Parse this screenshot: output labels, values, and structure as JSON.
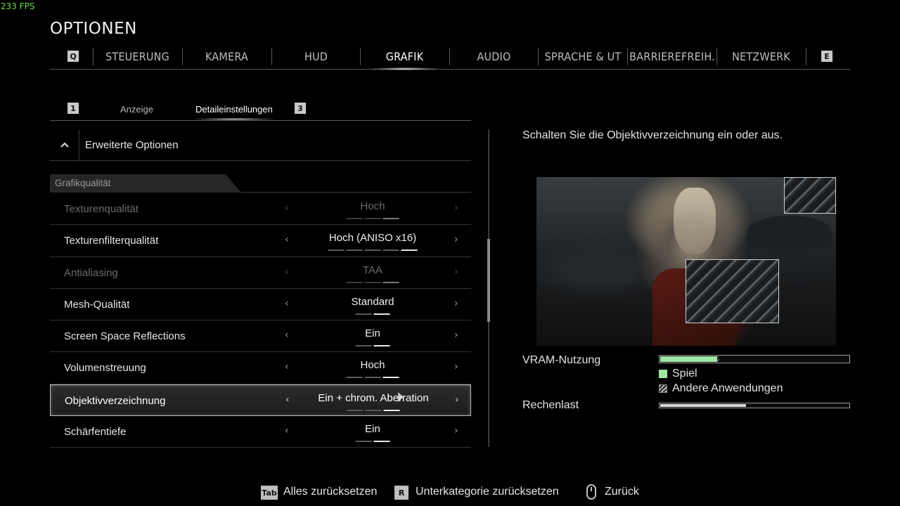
{
  "fps": "233 FPS",
  "title": "OPTIONEN",
  "top_tabs": {
    "left_key": "Q",
    "right_key": "E",
    "items": [
      {
        "label": "STEUERUNG"
      },
      {
        "label": "KAMERA"
      },
      {
        "label": "HUD"
      },
      {
        "label": "GRAFIK",
        "active": true
      },
      {
        "label": "AUDIO"
      },
      {
        "label": "SPRACHE & UT"
      },
      {
        "label": "BARRIEREFREIH."
      },
      {
        "label": "NETZWERK"
      }
    ]
  },
  "sub_tabs": {
    "left_key": "1",
    "right_key": "3",
    "items": [
      {
        "label": "Anzeige"
      },
      {
        "label": "Detaileinstellungen",
        "active": true
      }
    ]
  },
  "expander": {
    "label": "Erweiterte Optionen",
    "icon": "chevron-up-icon"
  },
  "section": {
    "label": "Grafikqualität"
  },
  "settings": [
    {
      "name": "Texturenqualität",
      "value": "Hoch",
      "level": 3,
      "levels": 3,
      "disabled": true
    },
    {
      "name": "Texturenfilterqualität",
      "value": "Hoch (ANISO x16)",
      "level": 5,
      "levels": 5
    },
    {
      "name": "Antialiasing",
      "value": "TAA",
      "level": 3,
      "levels": 3,
      "disabled": true
    },
    {
      "name": "Mesh-Qualität",
      "value": "Standard",
      "level": 2,
      "levels": 2
    },
    {
      "name": "Screen Space Reflections",
      "value": "Ein",
      "level": 2,
      "levels": 2
    },
    {
      "name": "Volumenstreuung",
      "value": "Hoch",
      "level": 3,
      "levels": 3
    },
    {
      "name": "Objektivverzeichnung",
      "value": "Ein + chrom. Aberration",
      "level": 3,
      "levels": 3,
      "selected": true
    },
    {
      "name": "Schärfentiefe",
      "value": "Ein",
      "level": 2,
      "levels": 2
    }
  ],
  "description": "Schalten Sie die Objektivverzeichnung ein oder aus.",
  "vram": {
    "label": "VRAM-Nutzung",
    "game_fraction": 0.3,
    "other_fraction": 0.01,
    "legend": {
      "game": "Spiel",
      "other": "Andere Anwendungen"
    },
    "colors": {
      "game": "#9ee6a4"
    }
  },
  "load": {
    "label": "Rechenlast",
    "fraction": 0.45
  },
  "footer": [
    {
      "key": "Tab",
      "label": "Alles zurücksetzen"
    },
    {
      "key": "R",
      "label": "Unterkategorie zurücksetzen"
    },
    {
      "key": "mouse-icon",
      "label": "Zurück"
    }
  ]
}
